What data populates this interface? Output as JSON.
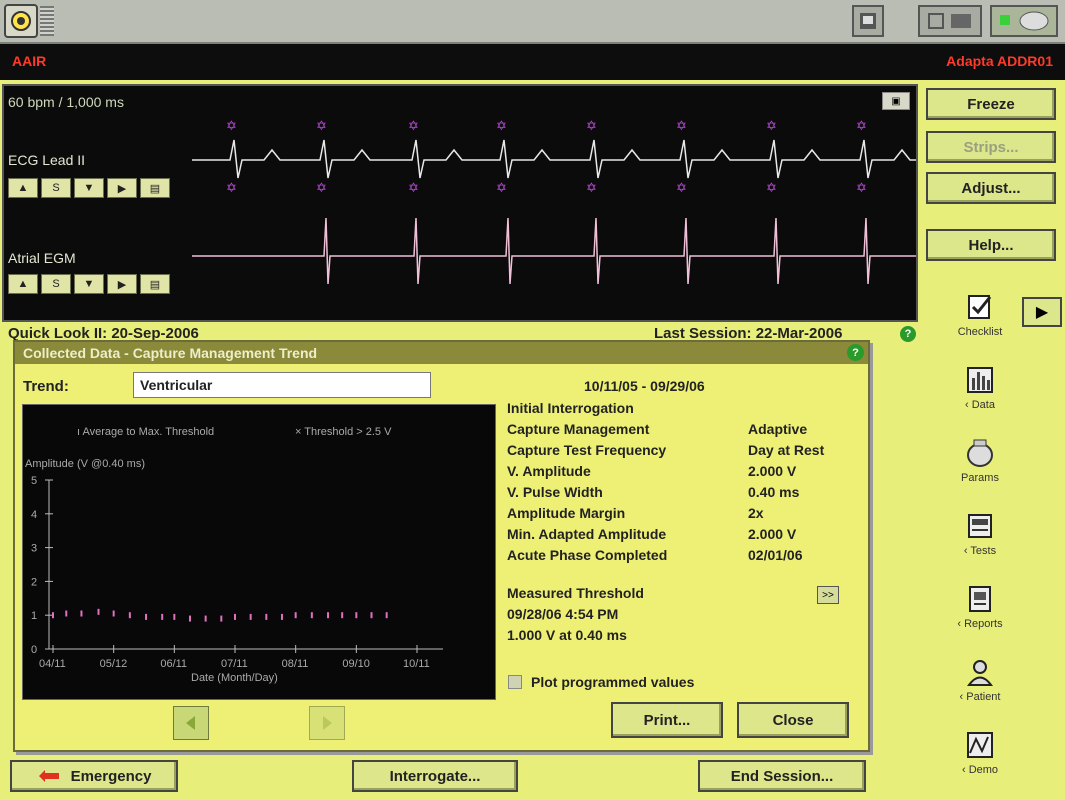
{
  "status": {
    "mode": "AAIR",
    "device": "Adapta ADDR01"
  },
  "ecg": {
    "rate_label": "60 bpm / 1,000 ms",
    "lead1_label": "ECG Lead II",
    "lead2_label": "Atrial EGM",
    "ctrl_s": "S"
  },
  "right_buttons": {
    "freeze": "Freeze",
    "strips": "Strips...",
    "adjust": "Adjust...",
    "help": "Help..."
  },
  "right_icons": {
    "checklist": "Checklist",
    "data": "Data",
    "params": "Params",
    "tests": "Tests",
    "reports": "Reports",
    "patient": "Patient",
    "demo": "Demo"
  },
  "quick_look": {
    "left": "Quick Look II: 20-Sep-2006",
    "right": "Last Session: 22-Mar-2006"
  },
  "dialog": {
    "title": "Collected Data - Capture Management Trend",
    "trend_label": "Trend:",
    "trend_value": "Ventricular",
    "date_range": "10/11/05 - 09/29/06",
    "legend_avg": "Average to Max. Threshold",
    "legend_x": "Threshold > 2.5 V",
    "initial_title": "Initial Interrogation",
    "rows": [
      {
        "label": "Capture Management",
        "value": "Adaptive"
      },
      {
        "label": "Capture Test Frequency",
        "value": "Day at Rest"
      },
      {
        "label": "V. Amplitude",
        "value": "2.000 V"
      },
      {
        "label": "V. Pulse Width",
        "value": "0.40 ms"
      },
      {
        "label": "Amplitude Margin",
        "value": "2x"
      },
      {
        "label": "Min. Adapted Amplitude",
        "value": "2.000 V"
      },
      {
        "label": "Acute Phase Completed",
        "value": "02/01/06"
      }
    ],
    "measured_title": "Measured Threshold",
    "measured_date": "09/28/06 4:54 PM",
    "measured_value": "1.000 V at 0.40 ms",
    "plot_label": "Plot programmed values",
    "print": "Print...",
    "close": "Close"
  },
  "bottom": {
    "emergency": "Emergency",
    "interrogate": "Interrogate...",
    "end_session": "End Session..."
  },
  "chart_data": {
    "type": "scatter",
    "ylabel": "Amplitude (V @0.40 ms)",
    "xlabel": "Date (Month/Day)",
    "ylim": [
      0,
      5
    ],
    "yticks": [
      "0",
      "1",
      "2",
      "3",
      "4",
      "5"
    ],
    "xticks": [
      "04/11",
      "05/12",
      "06/11",
      "07/11",
      "08/11",
      "09/10",
      "10/11"
    ],
    "series": [
      {
        "name": "Average to Max. Threshold",
        "x": [
          "04/11",
          "04/18",
          "04/26",
          "05/04",
          "05/12",
          "05/20",
          "05/28",
          "06/05",
          "06/11",
          "06/19",
          "06/27",
          "07/04",
          "07/11",
          "07/19",
          "07/27",
          "08/04",
          "08/11",
          "08/19",
          "08/27",
          "09/03",
          "09/10",
          "09/18",
          "09/26"
        ],
        "values": [
          1.0,
          1.05,
          1.05,
          1.1,
          1.05,
          1.0,
          0.95,
          0.95,
          0.95,
          0.9,
          0.9,
          0.9,
          0.95,
          0.95,
          0.95,
          0.95,
          1.0,
          1.0,
          1.0,
          1.0,
          1.0,
          1.0,
          1.0
        ]
      }
    ],
    "colors": {
      "points": "#e070c0",
      "axes": "#bbbbbb"
    }
  }
}
